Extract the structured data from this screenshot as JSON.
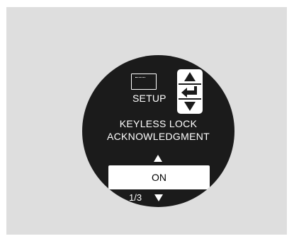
{
  "display": {
    "setup_label": "SETUP",
    "title_line1": "KEYLESS LOCK",
    "title_line2": "ACKNOWLEDGMENT",
    "value": "ON",
    "page_indicator": "1/3",
    "icons": [
      "setup-icon",
      "up-arrow-icon",
      "enter-icon",
      "down-arrow-icon"
    ]
  },
  "colors": {
    "background": "#dedede",
    "screen": "#1b1b1b",
    "text": "#ffffff"
  }
}
